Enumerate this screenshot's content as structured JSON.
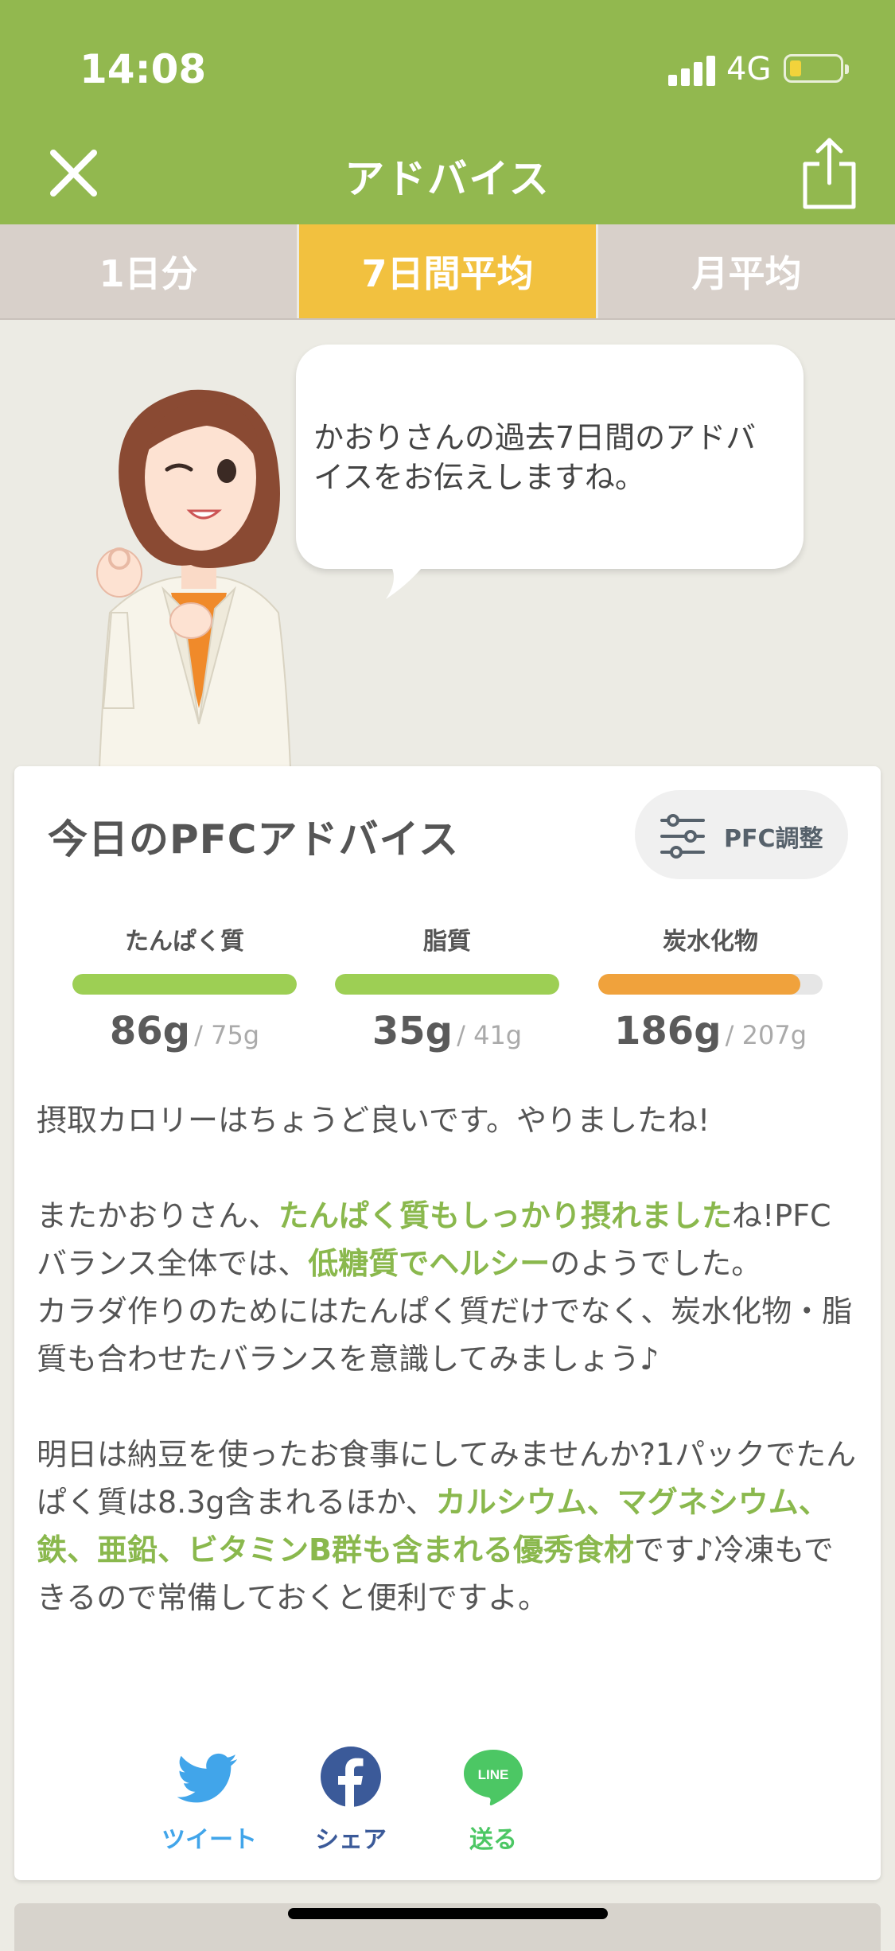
{
  "status_bar": {
    "time": "14:08",
    "network": "4G"
  },
  "header": {
    "title": "アドバイス"
  },
  "tabs": [
    {
      "label": "1日分",
      "active": false
    },
    {
      "label": "7日間平均",
      "active": true
    },
    {
      "label": "月平均",
      "active": false
    }
  ],
  "bubble": {
    "text": "かおりさんの過去7日間のアドバイスをお伝えしますね。"
  },
  "card": {
    "title": "今日のPFCアドバイス",
    "pfc_button": "PFC調整",
    "nutrients": [
      {
        "name": "たんぱく質",
        "actual": "86g",
        "target": "/ 75g",
        "progress": 1.0,
        "color": "#9dcf54"
      },
      {
        "name": "脂質",
        "actual": "35g",
        "target": "/ 41g",
        "progress": 1.0,
        "color": "#9dcf54"
      },
      {
        "name": "炭水化物",
        "actual": "186g",
        "target": "/ 207g",
        "progress": 0.9,
        "color": "#f0a23c"
      }
    ],
    "advice": {
      "p1": "摂取カロリーはちょうど良いです。やりましたね!",
      "p2_a": "またかおりさん、",
      "p2_hl1": "たんぱく質もしっかり摂れました",
      "p2_b": "ね!PFCバランス全体では、",
      "p2_hl2": "低糖質でヘルシー",
      "p2_c": "のようでした。",
      "p2_d": "カラダ作りのためにはたんぱく質だけでなく、炭水化物・脂質も合わせたバランスを意識してみましょう♪",
      "p3_a": "明日は納豆を使ったお食事にしてみませんか?1パックでたんぱく質は8.3g含まれるほか、",
      "p3_hl": "カルシウム、マグネシウム、鉄、亜鉛、ビタミンB群も含まれる優秀食材",
      "p3_b": "です♪冷凍もできるので常備しておくと便利ですよ。"
    },
    "social": [
      {
        "label": "ツイート",
        "icon": "twitter-icon",
        "color": "#41a5ea"
      },
      {
        "label": "シェア",
        "icon": "facebook-icon",
        "color": "#3b5a99"
      },
      {
        "label": "送る",
        "icon": "line-icon",
        "color": "#4cc764"
      },
      {
        "line_icon_text": "LINE"
      }
    ]
  },
  "colors": {
    "header": "#92b84f",
    "tab_active": "#f2c13f",
    "highlight": "#8ab84d"
  }
}
